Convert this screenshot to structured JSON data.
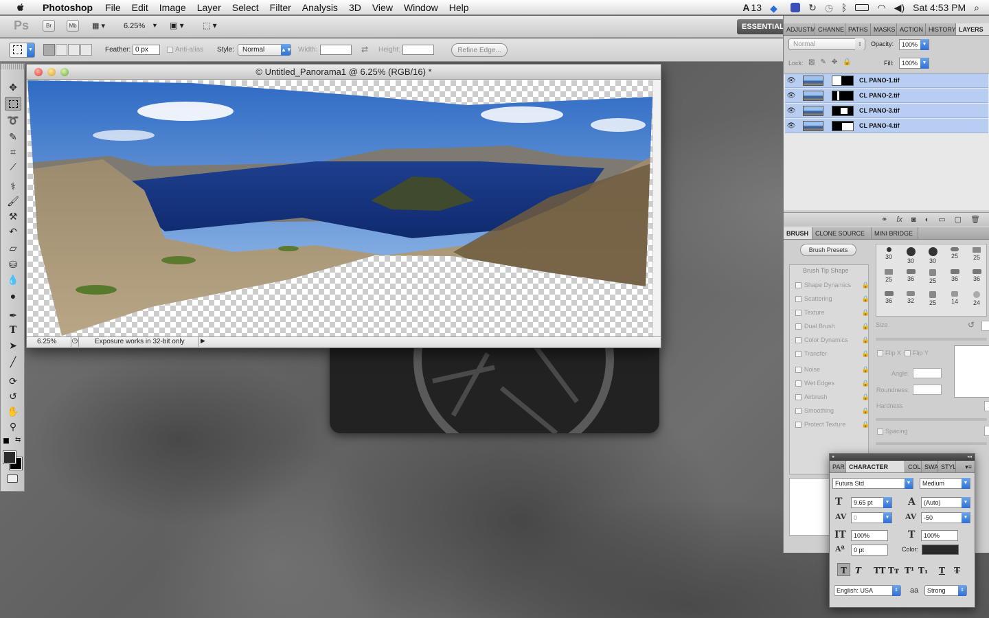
{
  "menubar": {
    "app_name": "Photoshop",
    "items": [
      "File",
      "Edit",
      "Image",
      "Layer",
      "Select",
      "Filter",
      "Analysis",
      "3D",
      "View",
      "Window",
      "Help"
    ],
    "adobe_badge": "13",
    "clock": "Sat 4:53 PM"
  },
  "appbar": {
    "ps_logo": "Ps",
    "br_button": "Br",
    "mb_button": "Mb",
    "zoom": "6.25%",
    "workspace": "ESSENTIALS"
  },
  "options": {
    "feather_label": "Feather:",
    "feather_value": "0 px",
    "antialias_label": "Anti-alias",
    "style_label": "Style:",
    "style_value": "Normal",
    "width_label": "Width:",
    "height_label": "Height:",
    "refine_edge": "Refine Edge..."
  },
  "document": {
    "title": "© Untitled_Panorama1 @ 6.25% (RGB/16) *",
    "zoom": "6.25%",
    "status_text": "Exposure works in 32-bit only"
  },
  "layers_panel": {
    "tabs": [
      "ADJUSTM",
      "CHANNE",
      "PATHS",
      "MASKS",
      "ACTION",
      "HISTORY",
      "LAYERS"
    ],
    "active_tab": "LAYERS",
    "blend_mode": "Normal",
    "opacity_label": "Opacity:",
    "opacity": "100%",
    "lock_label": "Lock:",
    "fill_label": "Fill:",
    "fill": "100%",
    "layers": [
      {
        "name": "CL PANO-1.tif"
      },
      {
        "name": "CL PANO-2.tif"
      },
      {
        "name": "CL PANO-3.tif"
      },
      {
        "name": "CL PANO-4.tif"
      }
    ]
  },
  "brush_panel": {
    "tabs": [
      "BRUSH",
      "CLONE SOURCE",
      "MINI BRIDGE"
    ],
    "active_tab": "BRUSH",
    "presets_button": "Brush Presets",
    "tip_shape": "Brush Tip Shape",
    "options": [
      "Shape Dynamics",
      "Scattering",
      "Texture",
      "Dual Brush",
      "Color Dynamics",
      "Transfer",
      "Noise",
      "Wet Edges",
      "Airbrush",
      "Smoothing",
      "Protect Texture"
    ],
    "brush_sizes": [
      "30",
      "30",
      "30",
      "25",
      "25",
      "25",
      "36",
      "25",
      "36",
      "36",
      "36",
      "32",
      "25",
      "14",
      "24"
    ],
    "size_label": "Size",
    "flip_x": "Flip X",
    "flip_y": "Flip Y",
    "angle_label": "Angle:",
    "roundness_label": "Roundness:",
    "hardness_label": "Hardness",
    "spacing_label": "Spacing"
  },
  "character_panel": {
    "tabs": [
      "PAR",
      "CHARACTER",
      "COL",
      "SWA",
      "STYL"
    ],
    "active_tab": "CHARACTER",
    "font_family": "Futura Std",
    "font_style": "Medium",
    "font_size": "9.65 pt",
    "leading": "(Auto)",
    "kerning": "0",
    "tracking": "-50",
    "vertical_scale": "100%",
    "horizontal_scale": "100%",
    "baseline_shift": "0 pt",
    "color_label": "Color:",
    "text_color": "#2b2b2b",
    "style_buttons": [
      "T",
      "T",
      "TT",
      "Tт",
      "T¹",
      "T₁",
      "T",
      "T"
    ],
    "language": "English: USA",
    "aa_label": "aa",
    "antialias": "Strong"
  }
}
